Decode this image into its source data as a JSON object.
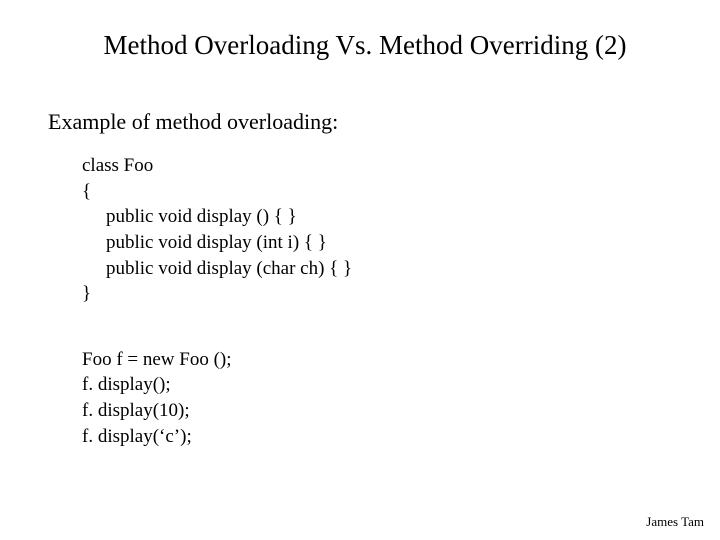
{
  "title": "Method Overloading Vs. Method Overriding (2)",
  "subtitle": "Example of method overloading:",
  "code": {
    "line1": "class Foo",
    "line2": "{",
    "line3": "public void display () { }",
    "line4": "public void display (int i) { }",
    "line5": "public void display (char ch) { }",
    "line6": "}"
  },
  "usage": {
    "line1": "Foo f = new Foo ();",
    "line2": "f. display();",
    "line3": "f. display(10);",
    "line4": "f. display(‘c’);"
  },
  "footer": "James Tam"
}
